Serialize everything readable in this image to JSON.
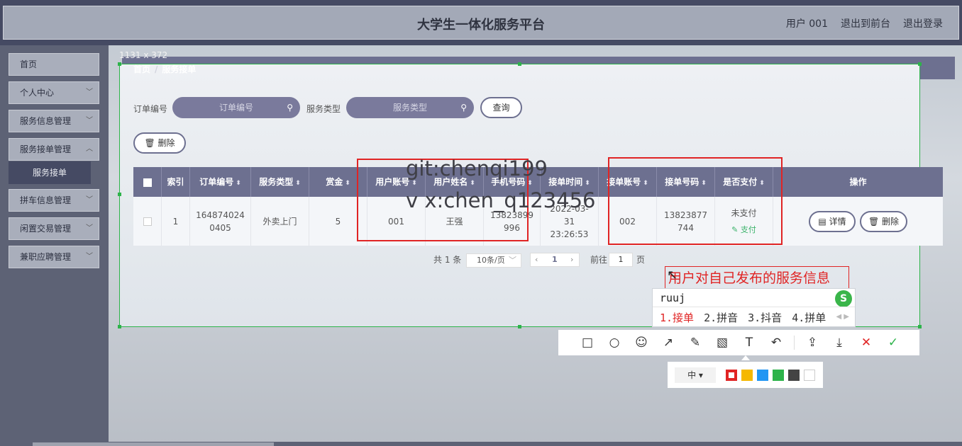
{
  "app": {
    "title": "大学生一体化服务平台",
    "user": "用户 001",
    "back_to_front": "退出到前台",
    "logout": "退出登录"
  },
  "sidebar": {
    "items": [
      {
        "label": "首页"
      },
      {
        "label": "个人中心"
      },
      {
        "label": "服务信息管理"
      },
      {
        "label": "服务接单管理"
      },
      {
        "label": "拼车信息管理"
      },
      {
        "label": "闲置交易管理"
      },
      {
        "label": "兼职应聘管理"
      }
    ],
    "active_sub": "服务接单"
  },
  "capture": {
    "size_label": "1131 x 372"
  },
  "breadcrumb": {
    "home": "首页",
    "sep": "/",
    "current": "服务接单"
  },
  "search": {
    "order_label": "订单编号",
    "order_placeholder": "订单编号",
    "type_label": "服务类型",
    "type_placeholder": "服务类型",
    "query_button": "查询",
    "delete_button": "删除"
  },
  "table": {
    "headers": [
      "索引",
      "订单编号",
      "服务类型",
      "赏金",
      "用户账号",
      "用户姓名",
      "手机号码",
      "接单时间",
      "接单账号",
      "接单号码",
      "是否支付",
      "操作"
    ],
    "rows": [
      {
        "index": "1",
        "order_no": "1648740240405",
        "service_type": "外卖上门",
        "reward": "5",
        "user_account": "001",
        "user_name": "王强",
        "phone": "13823899996",
        "time": "2022-03-31 23:26:53",
        "taker_account": "002",
        "taker_phone": "13823877744",
        "paid_status": "未支付",
        "pay_link": "支付",
        "detail_button": "详情",
        "delete_button": "删除"
      }
    ]
  },
  "pagination": {
    "total": "共 1 条",
    "page_size": "10条/页",
    "current_page": "1",
    "goto_label": "前往",
    "goto_value": "1",
    "page_unit": "页"
  },
  "watermark": {
    "line1": "git:chenqi199",
    "line2": "v x:chen_q123456"
  },
  "annotation": {
    "text": "用户对自己发布的服务信息"
  },
  "ime": {
    "input": "ruuj",
    "cand1": "1.接单",
    "cand2": "2.拼音",
    "cand3": "3.抖音",
    "cand4": "4.拼单",
    "logo": "S"
  },
  "colorbar": {
    "size": "中 ▾",
    "colors": [
      "#e02424",
      "#f5b800",
      "#2196f3",
      "#2db34a",
      "#444444",
      "#ffffff"
    ]
  }
}
